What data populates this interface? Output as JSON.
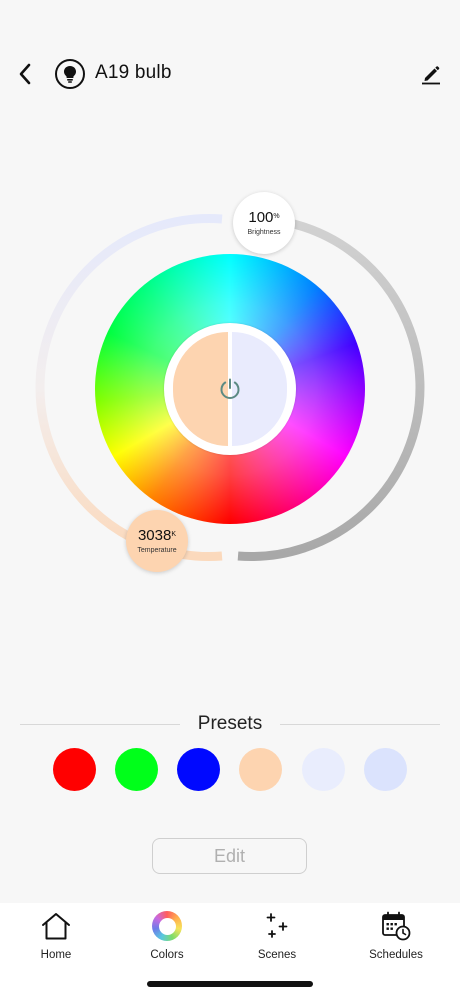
{
  "header": {
    "title": "A19 bulb",
    "back_icon": "chevron-left-icon",
    "device_icon": "lightbulb-icon",
    "edit_icon": "pencil-icon"
  },
  "light": {
    "brightness": {
      "value": "100",
      "unit": "%",
      "label": "Brightness",
      "level_fraction": 1.0
    },
    "temperature": {
      "value": "3038",
      "unit": "K",
      "label": "Temperature"
    },
    "power_icon": "power-icon",
    "warm_color": "#fdd4b0",
    "cool_color": "#e9ebfd"
  },
  "presets": {
    "title": "Presets",
    "items": [
      {
        "name": "red",
        "color": "#ff0000"
      },
      {
        "name": "green",
        "color": "#00ff1a"
      },
      {
        "name": "blue",
        "color": "#0008ff"
      },
      {
        "name": "warm",
        "color": "#fdd4b0"
      },
      {
        "name": "cool-light",
        "color": "#e9edfd"
      },
      {
        "name": "cool",
        "color": "#dbe3fd"
      }
    ]
  },
  "edit_button": {
    "label": "Edit"
  },
  "nav": {
    "items": [
      {
        "label": "Home",
        "icon": "home-icon"
      },
      {
        "label": "Colors",
        "icon": "color-wheel-icon"
      },
      {
        "label": "Scenes",
        "icon": "sparkles-icon"
      },
      {
        "label": "Schedules",
        "icon": "calendar-clock-icon"
      }
    ]
  }
}
